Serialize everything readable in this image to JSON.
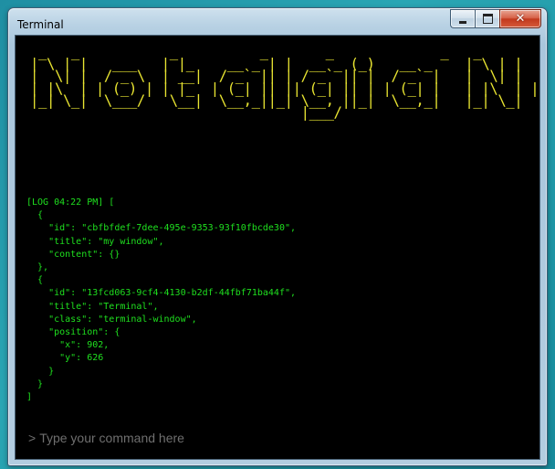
{
  "window": {
    "title": "Terminal",
    "controls": {
      "minimize": "minimize-icon",
      "maximize": "maximize-icon",
      "close": "close-icon",
      "close_glyph": "✕"
    }
  },
  "terminal": {
    "banner_text": "Nostalgia Nexus OS",
    "banner_art": "  _   _           _          _       _             _   _                                 ___    ____  \n | \\ | |   ___   | |_    __ _ | |  __ _ (_)   __ _    | \\ | |   ___  __  __  _   _   ___     / _ \\  / ___| \n |  \\| |  / _ \\  | __|  / _` || | / _` || |  / _` |   |  \\| |  / _ \\ \\ \\/ / | | | | / __|   | | | | \\___ \\ \n | |\\  | | (_) | | |_  | (_| || || (_| || | | (_| |   | |\\  | |  __/  >  <  | |_| | \\__ \\   | |_| |  ___) |\n |_| \\_|  \\___/   \\__|  \\__,_||_| \\__, ||_|  \\__,_|   |_| \\_|  \\___| /_/\\_\\  \\__,_| |___/    \\___/  |____/ \n                                  |___/                                                                     \n",
    "banner_color": "#e8e431",
    "log_color": "#1fe01f",
    "log_text": "[LOG 04:22 PM] [\n  {\n    \"id\": \"cbfbfdef-7dee-495e-9353-93f10fbcde30\",\n    \"title\": \"my window\",\n    \"content\": {}\n  },\n  {\n    \"id\": \"13fcd063-9cf4-4130-b2df-44fbf71ba44f\",\n    \"title\": \"Terminal\",\n    \"class\": \"terminal-window\",\n    \"position\": {\n      \"x\": 902,\n      \"y\": 626\n    }\n  }\n]",
    "prompt_symbol": ">",
    "input_placeholder": "Type your command here",
    "input_value": ""
  }
}
